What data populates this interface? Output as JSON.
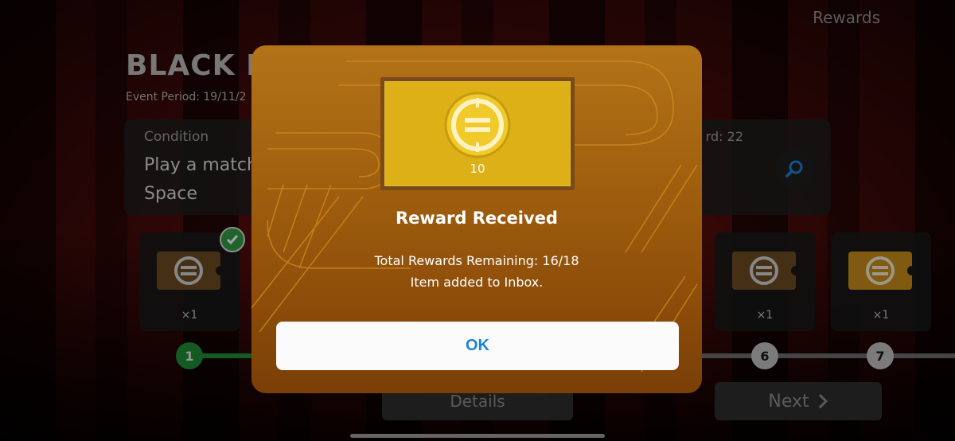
{
  "header": {
    "rewards_label": "Rewards"
  },
  "event": {
    "title": "BLACK FI",
    "period": "Event Period: 19/11/2"
  },
  "condition": {
    "label": "Condition",
    "text": "Play a match\nSpace",
    "reward_count": "rd: 22"
  },
  "rewards": [
    {
      "qty": "×1",
      "style": "dim"
    },
    {
      "qty": "×1",
      "style": "dim"
    },
    {
      "qty": "×1",
      "style": "gold"
    }
  ],
  "steps": [
    {
      "label": "1",
      "state": "done"
    },
    {
      "label": "6",
      "state": "todo"
    },
    {
      "label": "7",
      "state": "todo"
    }
  ],
  "buttons": {
    "details": "Details",
    "next": "Next"
  },
  "modal": {
    "coin_value": "10",
    "title": "Reward Received",
    "remaining": "Total Rewards Remaining: 16/18",
    "inbox_msg": "Item added to Inbox.",
    "ok_label": "OK"
  },
  "colors": {
    "modal_accent": "#a3620f",
    "coin_gold": "#dcb016",
    "ok_text": "#1d84d6",
    "done_green": "#1f8a36"
  },
  "icons": [
    "search-icon",
    "check-icon",
    "chevron-right-icon",
    "efootball-coin-icon"
  ]
}
